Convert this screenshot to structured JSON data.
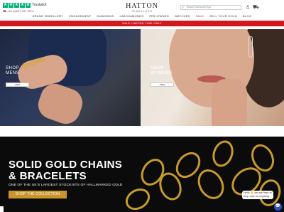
{
  "header": {
    "trustpilot_label": "Trustpilot",
    "phone": "☎ +44 (0)207 237 3374",
    "logo": {
      "main": "HATTON",
      "sub": "JEWELLERS"
    },
    "search_placeholder": "Search diamond rings",
    "icons": [
      "search-icon",
      "user-icon",
      "basket-icon"
    ]
  },
  "nav": {
    "items": [
      "BRAND JEWELLERY",
      "ENGAGEMENT",
      "DIAMONDS",
      "LAB DIAMONDS",
      "PRE-OWNED",
      "WATCHES",
      "SALE",
      "SELL YOUR GOLD",
      "BLOG"
    ]
  },
  "promo": {
    "text": "SALE LIMITED TIME ONLY"
  },
  "hero_men": {
    "label_line1": "SHOP",
    "label_line2": "MENS",
    "button": "VIEW"
  },
  "hero_women": {
    "label_line1": "SHOP",
    "label_line2": "WOMENS",
    "button": "VIEW"
  },
  "gold": {
    "title_line1": "SOLID GOLD CHAINS",
    "title_line2": "& BRACELETS",
    "subtitle": "ONE OF THE UK'S LARGEST STOCKISTS OF HALLMARKED GOLD",
    "button": "SHOP THE COLLECTION"
  },
  "chat": {
    "text": "Hello 👋 we are here to help. Ask us anything"
  },
  "colors": {
    "promo": "#d0181e",
    "gold_button": "#c8942b",
    "trustpilot": "#00b67a"
  }
}
